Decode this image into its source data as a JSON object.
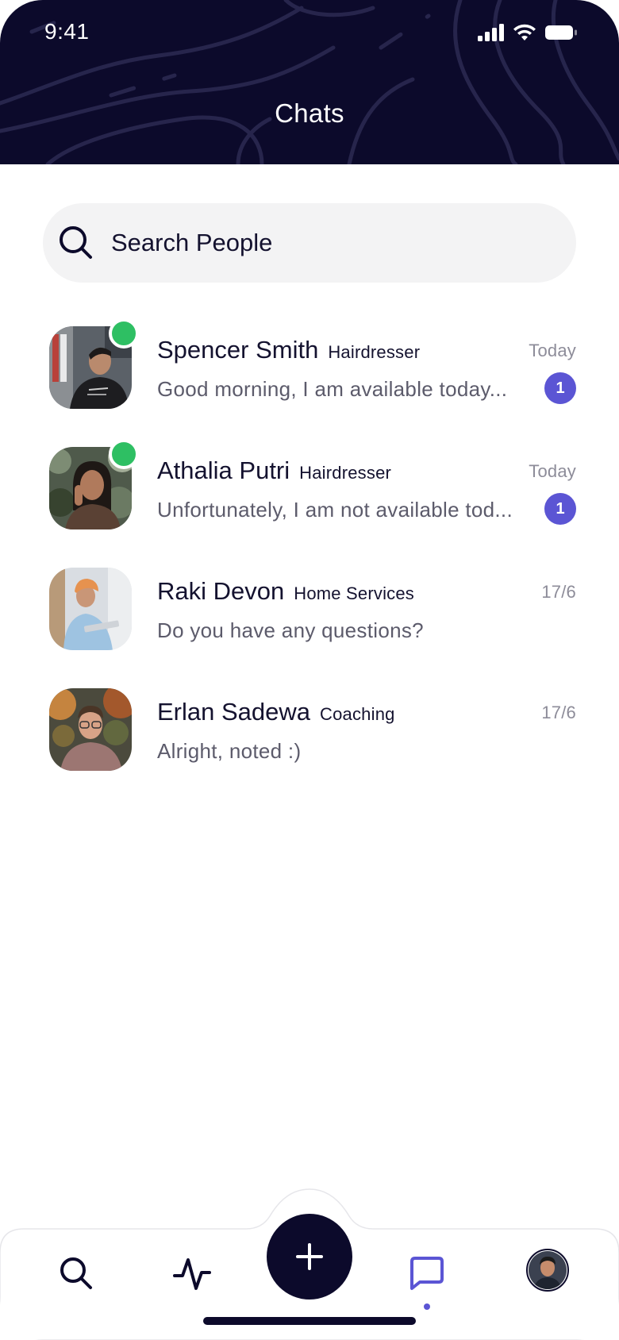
{
  "status_bar": {
    "time": "9:41"
  },
  "header": {
    "title": "Chats"
  },
  "search": {
    "placeholder": "Search People",
    "icon": "search-icon"
  },
  "chats": [
    {
      "name": "Spencer Smith",
      "category": "Hairdresser",
      "date": "Today",
      "message": "Good morning, I am available today...",
      "unread": "1",
      "online": true
    },
    {
      "name": "Athalia Putri",
      "category": "Hairdresser",
      "date": "Today",
      "message": "Unfortunately, I am not available tod...",
      "unread": "1",
      "online": true
    },
    {
      "name": "Raki Devon",
      "category": "Home Services",
      "date": "17/6",
      "message": "Do you have any questions?",
      "unread": null,
      "online": false
    },
    {
      "name": "Erlan Sadewa",
      "category": "Coaching",
      "date": "17/6",
      "message": "Alright, noted :)",
      "unread": null,
      "online": false
    }
  ],
  "bottom_nav": {
    "items": [
      "search-icon",
      "activity-icon",
      "plus-icon",
      "chat-icon",
      "profile-avatar"
    ],
    "active": "chat-icon"
  },
  "colors": {
    "header_bg": "#0c0a2b",
    "accent": "#5b55d4",
    "online": "#2ebf63",
    "search_bg": "#f3f3f4",
    "text_primary": "#14122f",
    "text_secondary": "#5c5b6b",
    "text_muted": "#8d8c99"
  }
}
